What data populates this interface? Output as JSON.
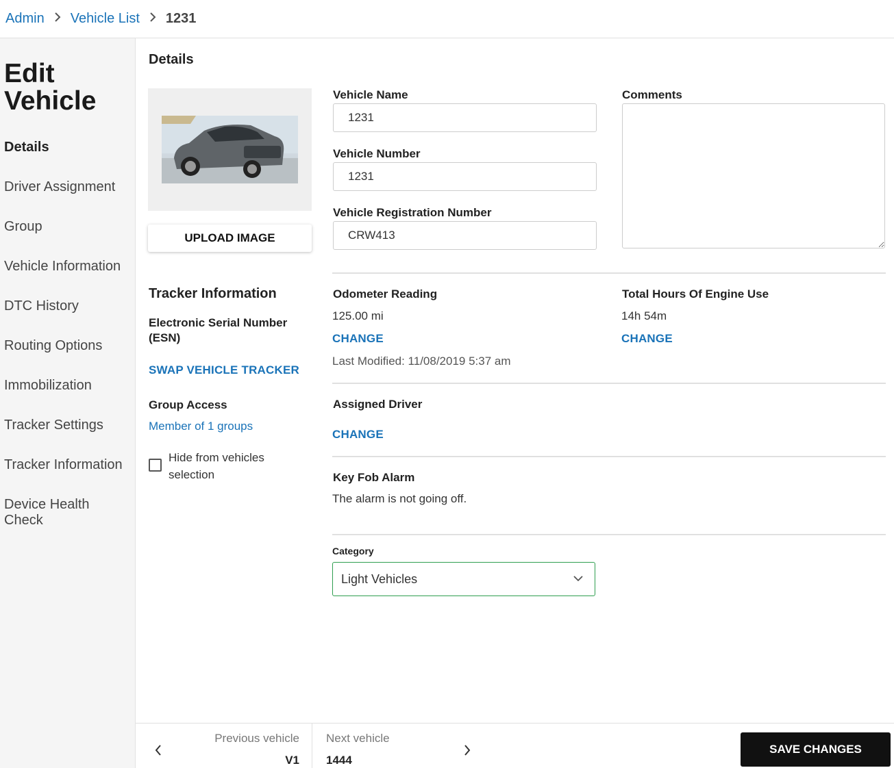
{
  "breadcrumb": {
    "items": [
      "Admin",
      "Vehicle List"
    ],
    "current": "1231"
  },
  "sidebar": {
    "title": "Edit Vehicle",
    "items": [
      {
        "label": "Details",
        "active": true
      },
      {
        "label": "Driver Assignment"
      },
      {
        "label": "Group"
      },
      {
        "label": "Vehicle Information"
      },
      {
        "label": "DTC History"
      },
      {
        "label": "Routing Options"
      },
      {
        "label": "Immobilization"
      },
      {
        "label": "Tracker Settings"
      },
      {
        "label": "Tracker Information"
      },
      {
        "label": "Device Health Check"
      }
    ]
  },
  "details": {
    "title": "Details",
    "upload_label": "UPLOAD IMAGE",
    "vehicle_name_label": "Vehicle Name",
    "vehicle_name_value": "1231",
    "vehicle_number_label": "Vehicle Number",
    "vehicle_number_value": "1231",
    "registration_label": "Vehicle Registration Number",
    "registration_value": "CRW413",
    "comments_label": "Comments",
    "comments_value": ""
  },
  "tracker": {
    "title": "Tracker Information",
    "esn_label": "Electronic Serial Number (ESN)",
    "swap_label": "SWAP VEHICLE TRACKER",
    "group_access_label": "Group Access",
    "group_access_link": "Member of 1 groups",
    "hide_label": "Hide from vehicles selection",
    "hide_checked": false
  },
  "odometer": {
    "label": "Odometer Reading",
    "value": "125.00 mi",
    "change_label": "CHANGE",
    "last_modified": "Last Modified: 11/08/2019 5:37 am"
  },
  "engine": {
    "label": "Total Hours Of Engine Use",
    "value": "14h 54m",
    "change_label": "CHANGE"
  },
  "driver": {
    "label": "Assigned Driver",
    "change_label": "CHANGE"
  },
  "keyfob": {
    "label": "Key Fob Alarm",
    "status": "The alarm is not going off."
  },
  "category": {
    "label": "Category",
    "selected": "Light Vehicles"
  },
  "footer": {
    "prev_caption": "Previous vehicle",
    "prev_value": "V1",
    "next_caption": "Next vehicle",
    "next_value": "1444",
    "save_label": "SAVE CHANGES"
  },
  "colors": {
    "link": "#1a73b8",
    "select_border": "#2e9e4f",
    "save_button": "#111111"
  },
  "icons": [
    "chevron-right-icon",
    "chevron-left-icon",
    "chevron-down-icon",
    "car-image"
  ]
}
